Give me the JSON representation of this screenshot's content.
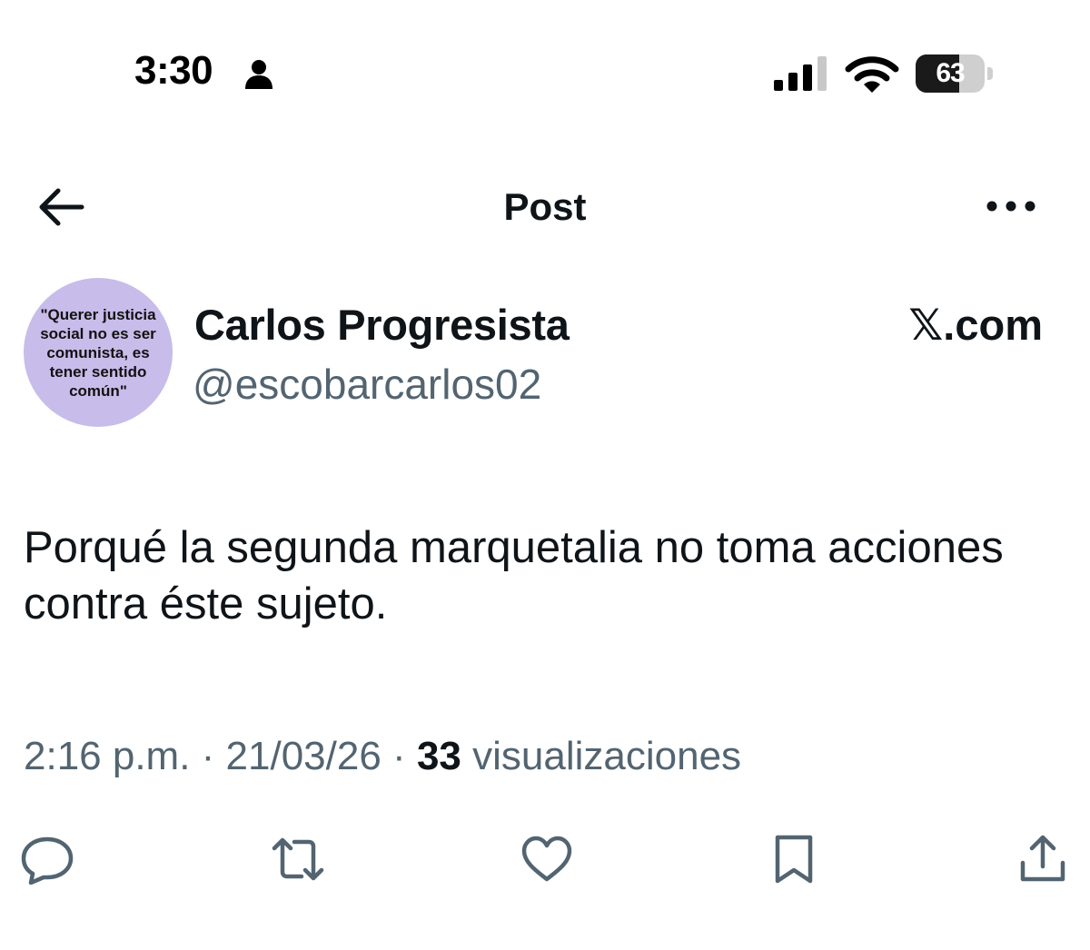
{
  "status_bar": {
    "time": "3:30",
    "battery_percent": "63",
    "battery_level": 0.63,
    "icons": [
      "person-icon",
      "signal-icon",
      "wifi-icon",
      "battery-icon"
    ]
  },
  "nav": {
    "title": "Post",
    "back_icon": "arrow-left-icon",
    "more_icon": "more-horizontal-icon"
  },
  "author": {
    "name": "Carlos Progresista",
    "handle": "@escobarcarlos02",
    "avatar_text": "\"Querer justicia social no es ser comunista, es tener sentido común\"",
    "source": "𝕏.com"
  },
  "tweet": {
    "text": "Porqué la segunda marquetalia no toma acciones contra éste sujeto."
  },
  "meta": {
    "time": "2:16 p.m.",
    "separator": " · ",
    "date": "21/03/26",
    "views_count": "33",
    "views_label": "visualizaciones"
  },
  "actions": [
    "reply-icon",
    "repost-icon",
    "like-icon",
    "bookmark-icon",
    "share-icon"
  ],
  "colors": {
    "text": "#0f1419",
    "secondary": "#536471",
    "avatar_bg": "#c8bcea"
  }
}
